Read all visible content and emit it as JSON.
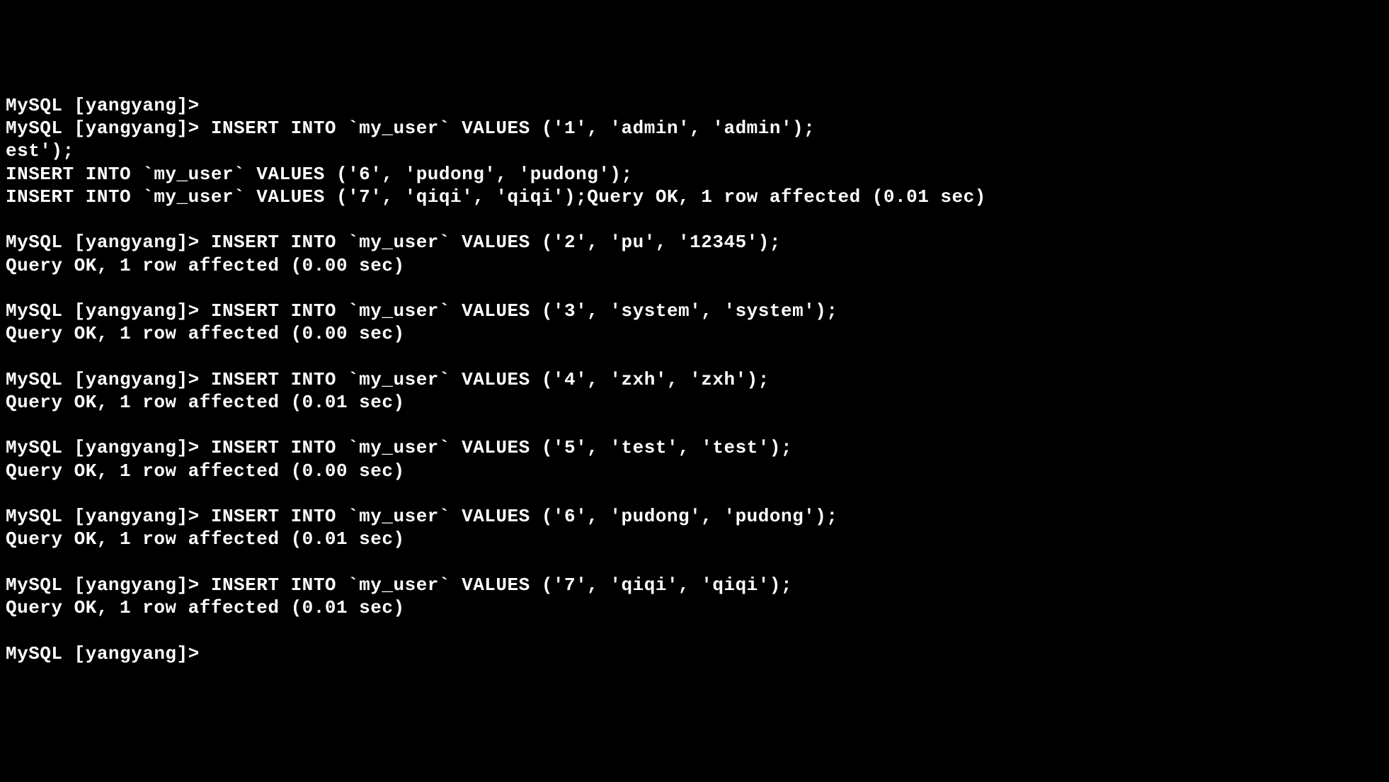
{
  "lines": [
    "MySQL [yangyang]>",
    "MySQL [yangyang]> INSERT INTO `my_user` VALUES ('1', 'admin', 'admin');",
    "est');",
    "INSERT INTO `my_user` VALUES ('6', 'pudong', 'pudong');",
    "INSERT INTO `my_user` VALUES ('7', 'qiqi', 'qiqi');Query OK, 1 row affected (0.01 sec)",
    "",
    "MySQL [yangyang]> INSERT INTO `my_user` VALUES ('2', 'pu', '12345');",
    "Query OK, 1 row affected (0.00 sec)",
    "",
    "MySQL [yangyang]> INSERT INTO `my_user` VALUES ('3', 'system', 'system');",
    "Query OK, 1 row affected (0.00 sec)",
    "",
    "MySQL [yangyang]> INSERT INTO `my_user` VALUES ('4', 'zxh', 'zxh');",
    "Query OK, 1 row affected (0.01 sec)",
    "",
    "MySQL [yangyang]> INSERT INTO `my_user` VALUES ('5', 'test', 'test');",
    "Query OK, 1 row affected (0.00 sec)",
    "",
    "MySQL [yangyang]> INSERT INTO `my_user` VALUES ('6', 'pudong', 'pudong');",
    "Query OK, 1 row affected (0.01 sec)",
    "",
    "MySQL [yangyang]> INSERT INTO `my_user` VALUES ('7', 'qiqi', 'qiqi');",
    "Query OK, 1 row affected (0.01 sec)",
    "",
    "MySQL [yangyang]>"
  ]
}
